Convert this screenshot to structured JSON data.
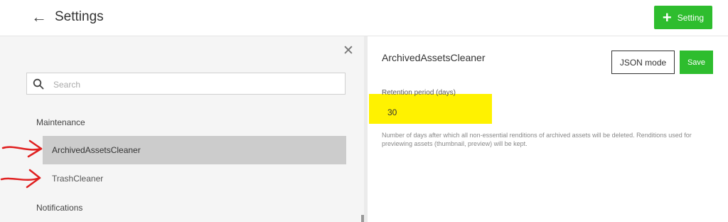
{
  "header": {
    "title": "Settings",
    "add_button_label": "Setting"
  },
  "sidebar": {
    "search_placeholder": "Search",
    "groups": [
      {
        "label": "Maintenance",
        "items": [
          {
            "label": "ArchivedAssetsCleaner",
            "active": true
          },
          {
            "label": "TrashCleaner",
            "active": false
          }
        ]
      },
      {
        "label": "Notifications",
        "items": []
      }
    ]
  },
  "detail": {
    "title": "ArchivedAssetsCleaner",
    "json_mode_label": "JSON mode",
    "save_label": "Save",
    "field": {
      "label": "Retention period (days)",
      "value": "30",
      "help": "Number of days after which all non-essential renditions of archived assets will be deleted. Renditions used for previewing assets (thumbnail, preview) will be kept."
    }
  },
  "colors": {
    "accent_green": "#2ebd2e",
    "highlight_yellow": "#fff200",
    "annotation_red": "#e02020",
    "active_item_bg": "#cccccc"
  }
}
